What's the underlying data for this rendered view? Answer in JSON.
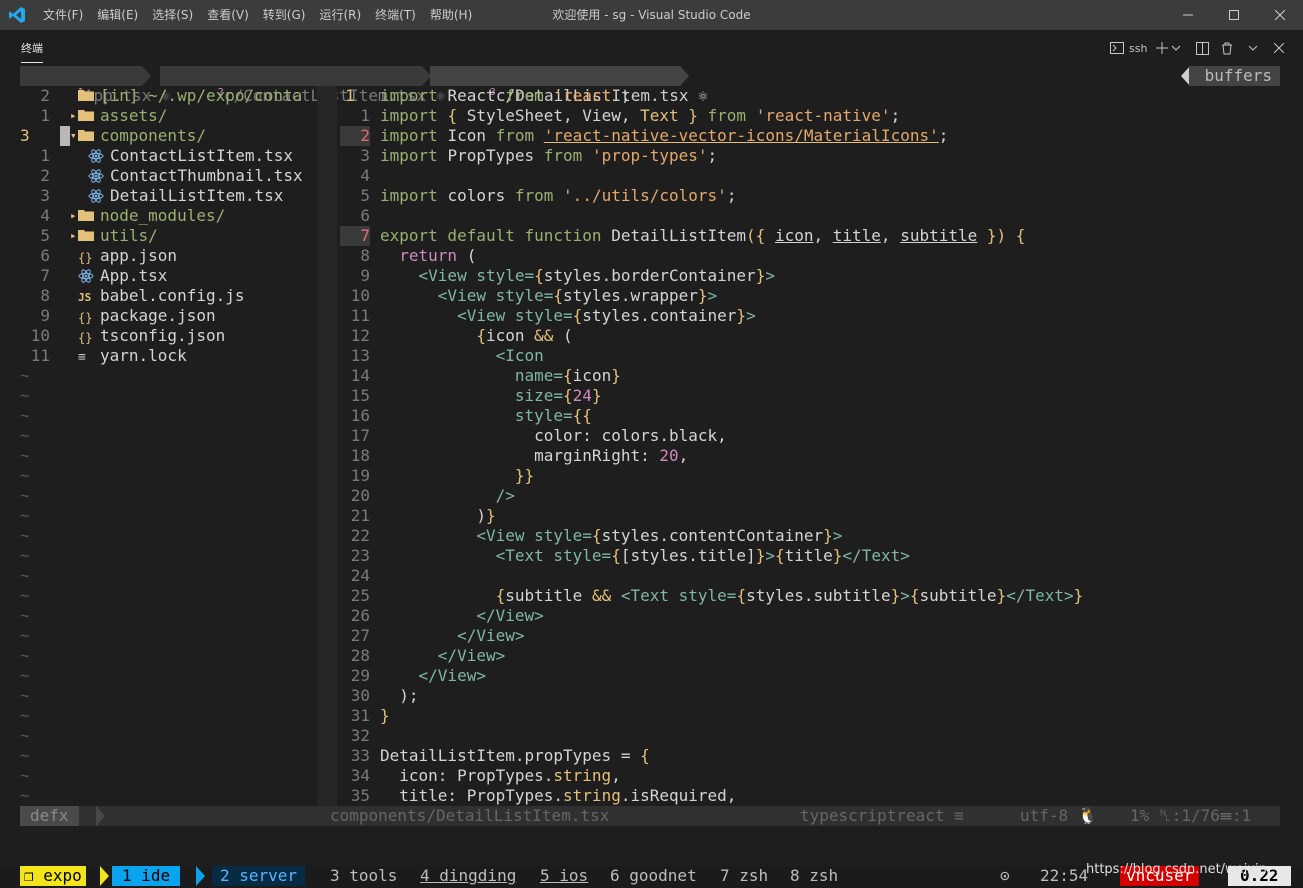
{
  "window": {
    "title": "欢迎使用 - sg - Visual Studio Code",
    "menu": [
      "文件(F)",
      "编辑(E)",
      "选择(S)",
      "查看(V)",
      "转到(G)",
      "运行(R)",
      "终端(T)",
      "帮助(H)"
    ]
  },
  "panel": {
    "tab_label": "终端",
    "terminal_name": "ssh",
    "actions": [
      "new-terminal",
      "split-terminal",
      "kill-terminal",
      "maximize",
      "close"
    ]
  },
  "tabline": {
    "tabs": [
      {
        "num": "1",
        "label": "App.tsx ⚛"
      },
      {
        "num": "2",
        "label": "c/ContactListItem.tsx ⚛"
      },
      {
        "num": "3",
        "label": "c/DetailListItem.tsx ⚛"
      }
    ],
    "right_label": "buffers"
  },
  "tree": {
    "rows": [
      {
        "num": "2",
        "arrow": "",
        "icon": "folder",
        "name": "[in] ~/.wp/expo/conta",
        "color": "#9ab071"
      },
      {
        "num": "1",
        "arrow": "▸",
        "icon": "folder",
        "name": "assets/",
        "color": "#9ab071"
      },
      {
        "num": "3",
        "arrow": "▾",
        "icon": "folder",
        "name": "components/",
        "color": "#9ab071",
        "current": true
      },
      {
        "num": "1",
        "arrow": "",
        "icon": "react",
        "name": "ContactListItem.tsx",
        "color": "#d4d4d4",
        "indent": true
      },
      {
        "num": "2",
        "arrow": "",
        "icon": "react",
        "name": "ContactThumbnail.tsx",
        "color": "#d4d4d4",
        "indent": true
      },
      {
        "num": "3",
        "arrow": "",
        "icon": "react",
        "name": "DetailListItem.tsx",
        "color": "#d4d4d4",
        "indent": true
      },
      {
        "num": "4",
        "arrow": "▸",
        "icon": "folder",
        "name": "node_modules/",
        "color": "#9ab071"
      },
      {
        "num": "5",
        "arrow": "▸",
        "icon": "folder",
        "name": "utils/",
        "color": "#9ab071"
      },
      {
        "num": "6",
        "arrow": "",
        "icon": "json",
        "name": "app.json",
        "color": "#d4d4d4"
      },
      {
        "num": "7",
        "arrow": "",
        "icon": "react",
        "name": "App.tsx",
        "color": "#d4d4d4"
      },
      {
        "num": "8",
        "arrow": "",
        "icon": "js",
        "name": "babel.config.js",
        "color": "#d4d4d4"
      },
      {
        "num": "9",
        "arrow": "",
        "icon": "json",
        "name": "package.json",
        "color": "#d4d4d4"
      },
      {
        "num": "10",
        "arrow": "",
        "icon": "json",
        "name": "tsconfig.json",
        "color": "#d4d4d4"
      },
      {
        "num": "11",
        "arrow": "",
        "icon": "lines",
        "name": "yarn.lock",
        "color": "#d4d4d4"
      }
    ],
    "tilde_rows": 22
  },
  "code": {
    "lines": [
      {
        "num": "1",
        "current": true,
        "segs": [
          [
            "k",
            "import "
          ],
          [
            "n",
            "React "
          ],
          [
            "k",
            "from "
          ],
          [
            "s",
            "'react'"
          ],
          [
            "n",
            ";"
          ]
        ]
      },
      {
        "num": "1",
        "segs": [
          [
            "k",
            "import "
          ],
          [
            "fn",
            "{ "
          ],
          [
            "n",
            "StyleSheet, View, "
          ],
          [
            "fn",
            "Text "
          ],
          [
            "fn",
            "} "
          ],
          [
            "k",
            "from "
          ],
          [
            "s",
            "'react-native'"
          ],
          [
            "n",
            ";"
          ]
        ]
      },
      {
        "num": "2",
        "error": true,
        "segs": [
          [
            "k",
            "import "
          ],
          [
            "n",
            "Icon "
          ],
          [
            "k",
            "from "
          ],
          [
            "su",
            "'react-native-vector-icons/MaterialIcons'"
          ],
          [
            "n",
            ";"
          ]
        ]
      },
      {
        "num": "3",
        "segs": [
          [
            "k",
            "import "
          ],
          [
            "n",
            "PropTypes "
          ],
          [
            "k",
            "from "
          ],
          [
            "s",
            "'prop-types'"
          ],
          [
            "n",
            ";"
          ]
        ]
      },
      {
        "num": "4",
        "segs": []
      },
      {
        "num": "5",
        "segs": [
          [
            "k",
            "import "
          ],
          [
            "n",
            "colors "
          ],
          [
            "k",
            "from "
          ],
          [
            "s",
            "'../utils/colors'"
          ],
          [
            "n",
            ";"
          ]
        ]
      },
      {
        "num": "6",
        "segs": []
      },
      {
        "num": "7",
        "error": true,
        "segs": [
          [
            "k",
            "export default function "
          ],
          [
            "n",
            "DetailListItem"
          ],
          [
            "fn",
            "({ "
          ],
          [
            "u",
            "icon"
          ],
          [
            "n",
            ", "
          ],
          [
            "u",
            "title"
          ],
          [
            "n",
            ", "
          ],
          [
            "u",
            "subtitle"
          ],
          [
            "fn",
            " }) {"
          ]
        ]
      },
      {
        "num": "8",
        "segs": [
          [
            "n",
            "  "
          ],
          [
            "num",
            "return "
          ],
          [
            "n",
            "("
          ]
        ]
      },
      {
        "num": "9",
        "segs": [
          [
            "n",
            "    "
          ],
          [
            "t",
            "<View style="
          ],
          [
            "fn",
            "{"
          ],
          [
            "n",
            "styles.borderContainer"
          ],
          [
            "fn",
            "}"
          ],
          [
            "t",
            ">"
          ]
        ]
      },
      {
        "num": "10",
        "segs": [
          [
            "n",
            "      "
          ],
          [
            "t",
            "<View style="
          ],
          [
            "fn",
            "{"
          ],
          [
            "n",
            "styles.wrapper"
          ],
          [
            "fn",
            "}"
          ],
          [
            "t",
            ">"
          ]
        ]
      },
      {
        "num": "11",
        "segs": [
          [
            "n",
            "        "
          ],
          [
            "t",
            "<View style="
          ],
          [
            "fn",
            "{"
          ],
          [
            "n",
            "styles.container"
          ],
          [
            "fn",
            "}"
          ],
          [
            "t",
            ">"
          ]
        ]
      },
      {
        "num": "12",
        "segs": [
          [
            "n",
            "          "
          ],
          [
            "fn",
            "{"
          ],
          [
            "n",
            "icon "
          ],
          [
            "pu",
            "&& "
          ],
          [
            "n",
            "("
          ]
        ]
      },
      {
        "num": "13",
        "segs": [
          [
            "n",
            "            "
          ],
          [
            "t",
            "<Icon"
          ]
        ]
      },
      {
        "num": "14",
        "segs": [
          [
            "n",
            "              "
          ],
          [
            "t",
            "name="
          ],
          [
            "fn",
            "{"
          ],
          [
            "n",
            "icon"
          ],
          [
            "fn",
            "}"
          ]
        ]
      },
      {
        "num": "15",
        "segs": [
          [
            "n",
            "              "
          ],
          [
            "t",
            "size="
          ],
          [
            "fn",
            "{"
          ],
          [
            "num",
            "24"
          ],
          [
            "fn",
            "}"
          ]
        ]
      },
      {
        "num": "16",
        "segs": [
          [
            "n",
            "              "
          ],
          [
            "t",
            "style="
          ],
          [
            "fn",
            "{{"
          ]
        ]
      },
      {
        "num": "17",
        "segs": [
          [
            "n",
            "                color: colors.black,"
          ]
        ]
      },
      {
        "num": "18",
        "segs": [
          [
            "n",
            "                marginRight: "
          ],
          [
            "num",
            "20"
          ],
          [
            "n",
            ","
          ]
        ]
      },
      {
        "num": "19",
        "segs": [
          [
            "n",
            "              "
          ],
          [
            "fn",
            "}}"
          ]
        ]
      },
      {
        "num": "20",
        "segs": [
          [
            "n",
            "            "
          ],
          [
            "t",
            "/>"
          ]
        ]
      },
      {
        "num": "21",
        "segs": [
          [
            "n",
            "          )"
          ],
          [
            "fn",
            "}"
          ]
        ]
      },
      {
        "num": "22",
        "segs": [
          [
            "n",
            "          "
          ],
          [
            "t",
            "<View style="
          ],
          [
            "fn",
            "{"
          ],
          [
            "n",
            "styles.contentContainer"
          ],
          [
            "fn",
            "}"
          ],
          [
            "t",
            ">"
          ]
        ]
      },
      {
        "num": "23",
        "segs": [
          [
            "n",
            "            "
          ],
          [
            "t",
            "<Text style="
          ],
          [
            "fn",
            "{"
          ],
          [
            "n",
            "[styles.title]"
          ],
          [
            "fn",
            "}"
          ],
          [
            "t",
            ">"
          ],
          [
            "fn",
            "{"
          ],
          [
            "n",
            "title"
          ],
          [
            "fn",
            "}"
          ],
          [
            "t",
            "</Text>"
          ]
        ]
      },
      {
        "num": "24",
        "segs": []
      },
      {
        "num": "25",
        "segs": [
          [
            "n",
            "            "
          ],
          [
            "fn",
            "{"
          ],
          [
            "n",
            "subtitle "
          ],
          [
            "pu",
            "&& "
          ],
          [
            "t",
            "<Text style="
          ],
          [
            "fn",
            "{"
          ],
          [
            "n",
            "styles.subtitle"
          ],
          [
            "fn",
            "}"
          ],
          [
            "t",
            ">"
          ],
          [
            "fn",
            "{"
          ],
          [
            "n",
            "subtitle"
          ],
          [
            "fn",
            "}"
          ],
          [
            "t",
            "</Text>"
          ],
          [
            "fn",
            "}"
          ]
        ]
      },
      {
        "num": "26",
        "segs": [
          [
            "n",
            "          "
          ],
          [
            "t",
            "</View>"
          ]
        ]
      },
      {
        "num": "27",
        "segs": [
          [
            "n",
            "        "
          ],
          [
            "t",
            "</View>"
          ]
        ]
      },
      {
        "num": "28",
        "segs": [
          [
            "n",
            "      "
          ],
          [
            "t",
            "</View>"
          ]
        ]
      },
      {
        "num": "29",
        "segs": [
          [
            "n",
            "    "
          ],
          [
            "t",
            "</View>"
          ]
        ]
      },
      {
        "num": "30",
        "segs": [
          [
            "n",
            "  );"
          ]
        ]
      },
      {
        "num": "31",
        "segs": [
          [
            "fn",
            "}"
          ]
        ]
      },
      {
        "num": "32",
        "segs": []
      },
      {
        "num": "33",
        "segs": [
          [
            "n",
            "DetailListItem.propTypes = "
          ],
          [
            "fn",
            "{"
          ]
        ]
      },
      {
        "num": "34",
        "segs": [
          [
            "n",
            "  icon: PropTypes."
          ],
          [
            "fn",
            "string"
          ],
          [
            "n",
            ","
          ]
        ]
      },
      {
        "num": "35",
        "segs": [
          [
            "n",
            "  title: PropTypes."
          ],
          [
            "fn",
            "string"
          ],
          [
            "n",
            ".isRequired,"
          ]
        ]
      }
    ]
  },
  "statusline": {
    "mode": "defx",
    "file": "components/DetailListItem.tsx",
    "filetype": "typescriptreact ≡",
    "encoding": "utf-8 🐧",
    "position": "1% ␤:1/76☰:1"
  },
  "tmux": {
    "session": "❐ expo",
    "windows": [
      {
        "label": "1 ide",
        "style": "current"
      },
      {
        "label": "2 server",
        "style": "last"
      },
      {
        "label": "3 tools",
        "style": "plain"
      },
      {
        "label": "4 dingding",
        "style": "underline"
      },
      {
        "label": "5 ios",
        "style": "underline"
      },
      {
        "label": "6 goodnet",
        "style": "plain"
      },
      {
        "label": "7 zsh",
        "style": "plain"
      },
      {
        "label": "8 zsh",
        "style": "plain"
      }
    ],
    "clock_icon": "⊙",
    "time": "22:54",
    "user": "vncuser",
    "load": "0.22"
  },
  "watermark": "https://blog.csdn.net/weixin..."
}
